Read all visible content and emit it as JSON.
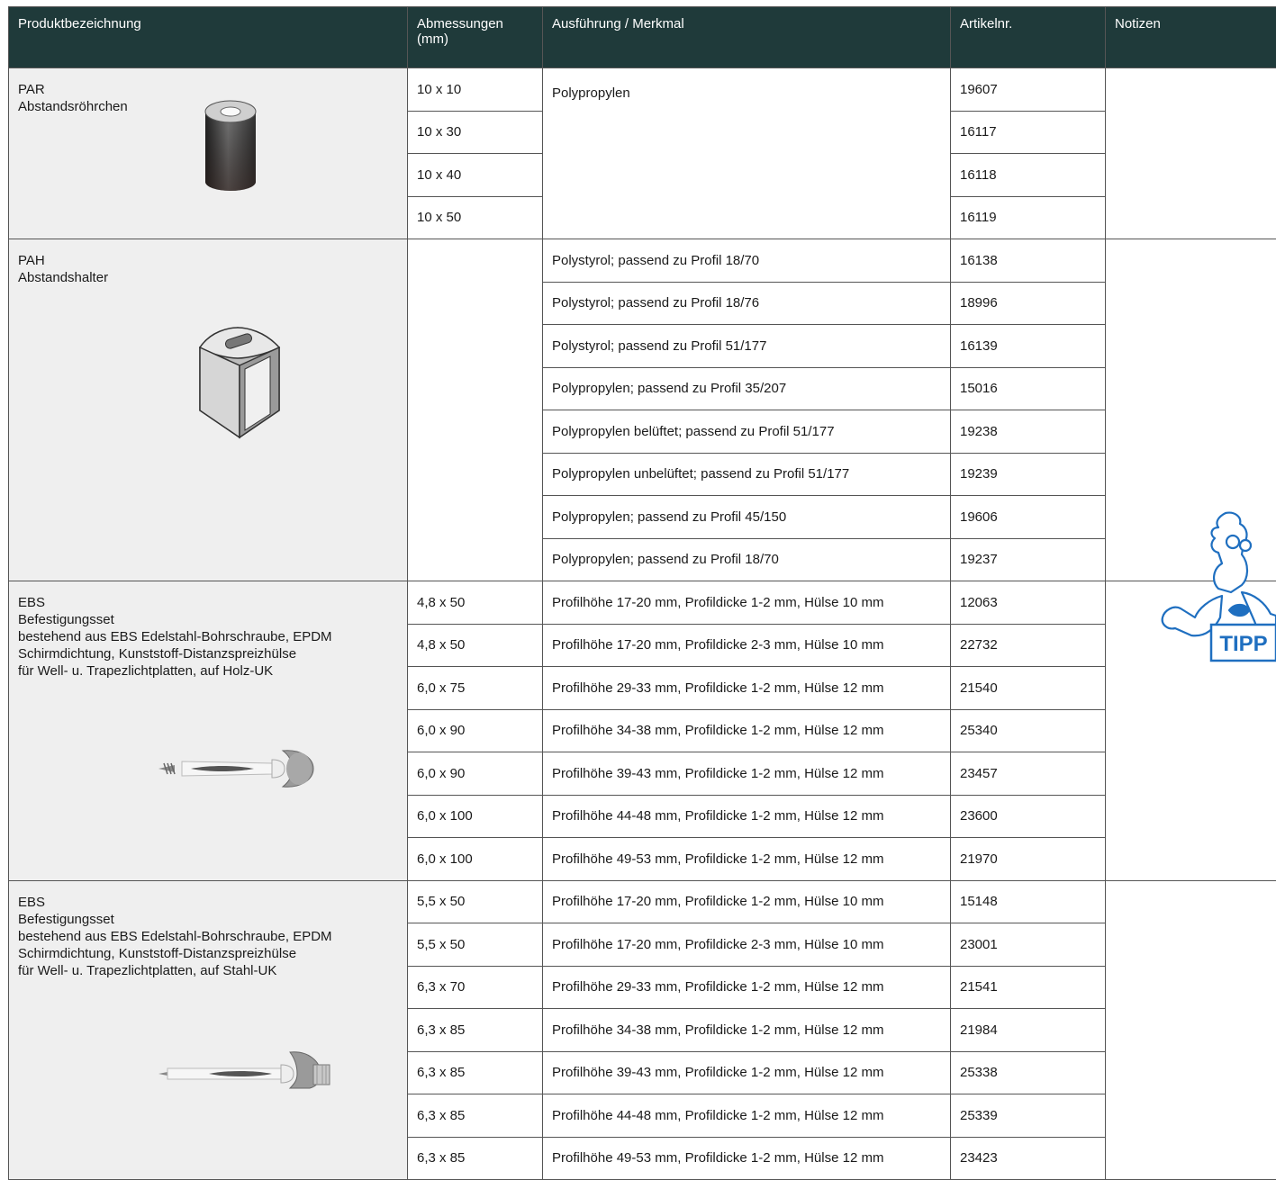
{
  "headers": {
    "product": "Produktbezeichnung",
    "dimensions_line1": "Abmessungen",
    "dimensions_line2": "(mm)",
    "feature": "Ausführung / Merkmal",
    "article": "Artikelnr.",
    "notes": "Notizen"
  },
  "products": [
    {
      "name": "PAR",
      "desc": [
        "Abstandsröhrchen"
      ],
      "icon": "spacer-tube-image",
      "rows": [
        {
          "dim": "10 x 10",
          "feature": "Polypropylen",
          "art": "19607"
        },
        {
          "dim": "10 x 30",
          "feature": "",
          "art": "16117"
        },
        {
          "dim": "10 x 40",
          "feature": "",
          "art": "16118"
        },
        {
          "dim": "10 x 50",
          "feature": "",
          "art": "16119"
        }
      ]
    },
    {
      "name": "PAH",
      "desc": [
        "Abstandshalter"
      ],
      "icon": "spacer-holder-image",
      "rows": [
        {
          "dim": "",
          "feature": "Polystyrol; passend zu Profil 18/70",
          "art": "16138"
        },
        {
          "dim": "",
          "feature": "Polystyrol; passend zu Profil 18/76",
          "art": "18996"
        },
        {
          "dim": "",
          "feature": "Polystyrol; passend zu Profil 51/177",
          "art": "16139"
        },
        {
          "dim": "",
          "feature": "Polypropylen; passend zu Profil 35/207",
          "art": "15016"
        },
        {
          "dim": "",
          "feature": "Polypropylen belüftet; passend zu Profil 51/177",
          "art": "19238"
        },
        {
          "dim": "",
          "feature": "Polypropylen unbelüftet; passend zu Profil 51/177",
          "art": "19239"
        },
        {
          "dim": "",
          "feature": "Polypropylen; passend zu Profil 45/150",
          "art": "19606"
        },
        {
          "dim": "",
          "feature": "Polypropylen; passend zu Profil 18/70",
          "art": "19237"
        }
      ]
    },
    {
      "name": "EBS",
      "desc": [
        "Befestigungsset",
        "bestehend aus EBS Edelstahl-Bohrschraube, EPDM",
        "Schirmdichtung, Kunststoff-Distanzspreizhülse",
        "für Well- u. Trapezlichtplatten, auf Holz-UK"
      ],
      "icon": "screw-set-wood-image",
      "rows": [
        {
          "dim": "4,8 x 50",
          "feature": "Profilhöhe 17-20 mm, Profildicke 1-2 mm, Hülse 10 mm",
          "art": "12063"
        },
        {
          "dim": "4,8 x 50",
          "feature": "Profilhöhe 17-20 mm, Profildicke 2-3 mm, Hülse 10 mm",
          "art": "22732"
        },
        {
          "dim": "6,0 x 75",
          "feature": "Profilhöhe 29-33 mm, Profildicke 1-2 mm, Hülse 12 mm",
          "art": "21540"
        },
        {
          "dim": "6,0 x 90",
          "feature": "Profilhöhe 34-38 mm, Profildicke 1-2 mm, Hülse 12 mm",
          "art": "25340"
        },
        {
          "dim": "6,0 x 90",
          "feature": "Profilhöhe 39-43 mm, Profildicke 1-2 mm, Hülse 12 mm",
          "art": "23457"
        },
        {
          "dim": "6,0 x 100",
          "feature": "Profilhöhe 44-48 mm, Profildicke 1-2 mm, Hülse 12 mm",
          "art": "23600"
        },
        {
          "dim": "6,0 x 100",
          "feature": "Profilhöhe 49-53 mm, Profildicke 1-2 mm, Hülse 12 mm",
          "art": "21970"
        }
      ]
    },
    {
      "name": "EBS",
      "desc": [
        "Befestigungsset",
        "bestehend aus EBS Edelstahl-Bohrschraube, EPDM",
        "Schirmdichtung, Kunststoff-Distanzspreizhülse",
        "für Well- u. Trapezlichtplatten, auf Stahl-UK"
      ],
      "icon": "screw-set-steel-image",
      "rows": [
        {
          "dim": "5,5 x 50",
          "feature": "Profilhöhe 17-20 mm, Profildicke 1-2 mm, Hülse 10 mm",
          "art": "15148"
        },
        {
          "dim": "5,5 x 50",
          "feature": "Profilhöhe 17-20 mm, Profildicke 2-3 mm, Hülse 10 mm",
          "art": "23001"
        },
        {
          "dim": "6,3 x 70",
          "feature": "Profilhöhe 29-33 mm, Profildicke 1-2 mm, Hülse 12 mm",
          "art": "21541"
        },
        {
          "dim": "6,3 x 85",
          "feature": "Profilhöhe 34-38 mm, Profildicke 1-2 mm, Hülse 12 mm",
          "art": "21984"
        },
        {
          "dim": "6,3 x 85",
          "feature": "Profilhöhe 39-43 mm, Profildicke 1-2 mm, Hülse 12 mm",
          "art": "25338"
        },
        {
          "dim": "6,3 x 85",
          "feature": "Profilhöhe 44-48 mm, Profildicke 1-2 mm, Hülse 12 mm",
          "art": "25339"
        },
        {
          "dim": "6,3 x 85",
          "feature": "Profilhöhe 49-53 mm, Profildicke 1-2 mm, Hülse 12 mm",
          "art": "23423"
        }
      ]
    }
  ],
  "tipp": {
    "label": "TIPP",
    "icon": "mascot-tipp-icon"
  },
  "colors": {
    "header_bg": "#1f3a3a",
    "product_bg": "#efefef",
    "tipp_blue": "#1f6fc0"
  }
}
